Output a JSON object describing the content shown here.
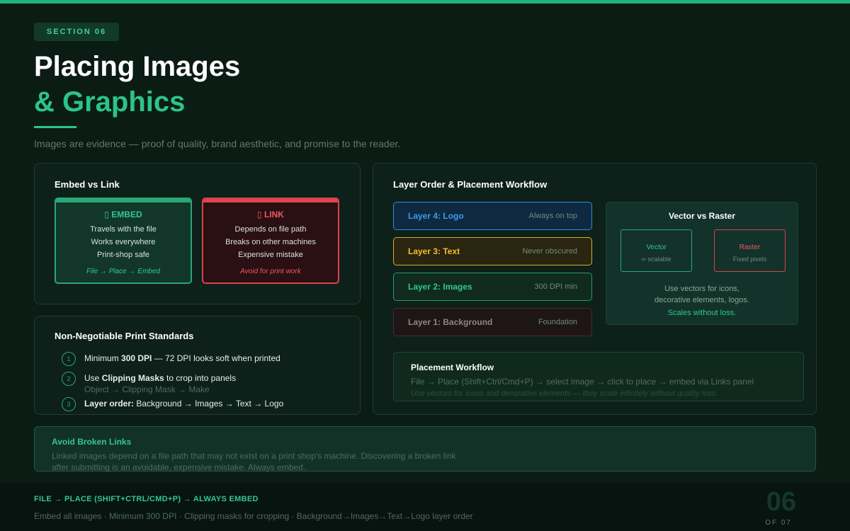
{
  "section_badge": "SECTION 06",
  "title_line1": "Placing Images",
  "title_line2": "& Graphics",
  "subtitle": "Images are evidence — proof of quality, brand aesthetic, and promise to the reader.",
  "embed_vs_link": {
    "title": "Embed vs Link",
    "embed": {
      "heading": "▯ EMBED",
      "lines": [
        "Travels with the file",
        "Works everywhere",
        "Print-shop safe"
      ],
      "footer": "File → Place → Embed"
    },
    "link": {
      "heading": "▯ LINK",
      "lines": [
        "Depends on file path",
        "Breaks on other machines",
        "Expensive mistake"
      ],
      "footer": "Avoid for print work"
    }
  },
  "standards": {
    "title": "Non-Negotiable Print Standards",
    "items": [
      {
        "num": "1",
        "pre": "Minimum ",
        "bold": "300 DPI",
        "post": " — 72 DPI looks soft when printed",
        "sub": ""
      },
      {
        "num": "2",
        "pre": "Use ",
        "bold": "Clipping Masks",
        "post": " to crop into panels",
        "sub": "Object → Clipping Mask → Make"
      },
      {
        "num": "3",
        "pre": "",
        "bold": "Layer order:",
        "post": " Background → Images → Text → Logo",
        "sub": ""
      }
    ]
  },
  "layers": {
    "title": "Layer Order & Placement Workflow",
    "items": [
      {
        "name": "Layer 4: Logo",
        "note": "Always on top"
      },
      {
        "name": "Layer 3: Text",
        "note": "Never obscured"
      },
      {
        "name": "Layer 2: Images",
        "note": "300 DPI min"
      },
      {
        "name": "Layer 1: Background",
        "note": "Foundation"
      }
    ]
  },
  "vector_raster": {
    "title": "Vector vs Raster",
    "vector_label": "Vector",
    "vector_sub": "∞ scalable",
    "raster_label": "Raster",
    "raster_sub": "Fixed pixels",
    "text_line1": "Use vectors for icons,",
    "text_line2": "decorative elements, logos.",
    "text_line3": "Scales without loss."
  },
  "workflow": {
    "title": "Placement Workflow",
    "line": "File → Place (Shift+Ctrl/Cmd+P) → select image → click to place → embed via Links panel",
    "italic": "Use vectors for icons and decorative elements — they scale infinitely without quality loss."
  },
  "avoid": {
    "title": "Avoid Broken Links",
    "line1": "Linked images depend on a file path that may not exist on a print shop's machine. Discovering a broken link",
    "line2": "after submitting is an avoidable, expensive mistake. Always embed."
  },
  "footer": {
    "headline": "FILE → PLACE (SHIFT+CTRL/CMD+P) → ALWAYS EMBED",
    "summary": "Embed all images · Minimum 300 DPI · Clipping masks for cropping · Background→Images→Text→Logo layer order",
    "page_number": "06",
    "page_total": "OF 07"
  }
}
